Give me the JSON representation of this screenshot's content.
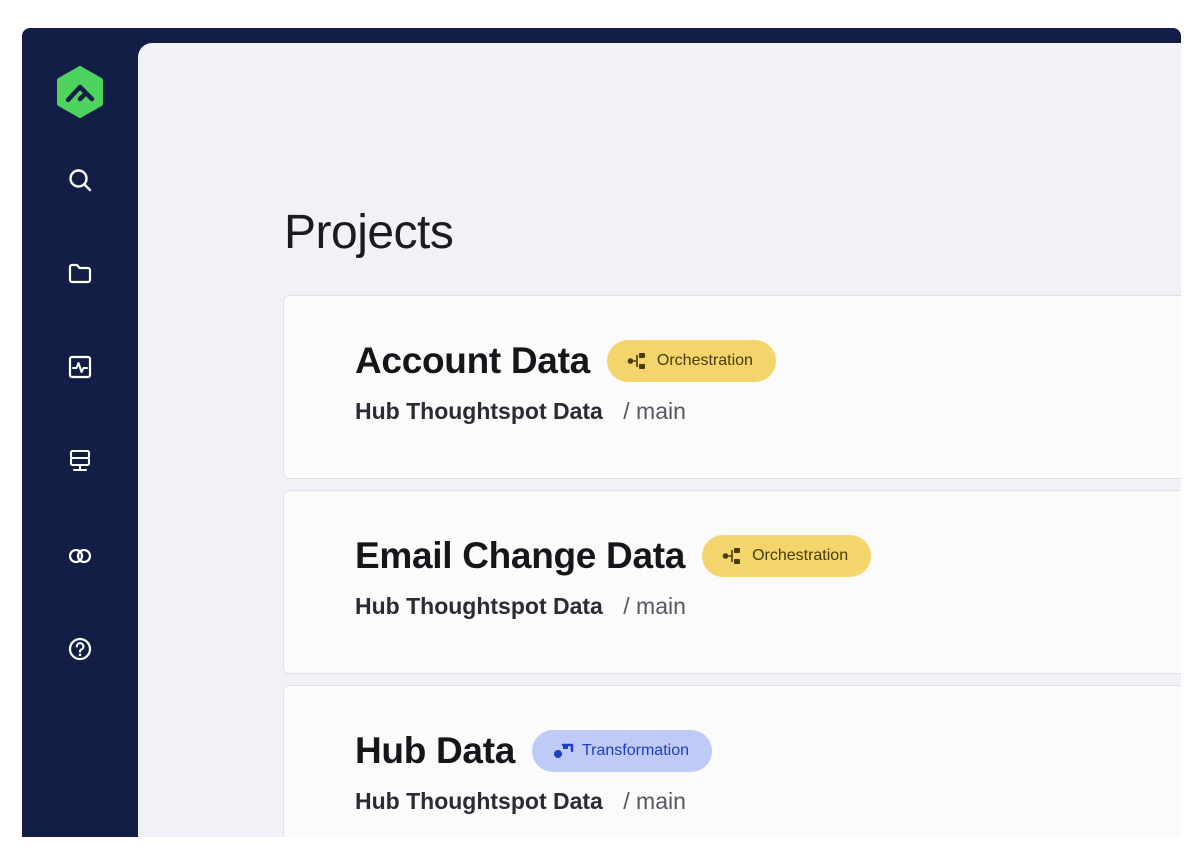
{
  "sidebar": {
    "items": [
      {
        "icon": "search-icon",
        "name": "sidebar-item-search"
      },
      {
        "icon": "folder-icon",
        "name": "sidebar-item-projects"
      },
      {
        "icon": "activity-monitor-icon",
        "name": "sidebar-item-activity"
      },
      {
        "icon": "server-icon",
        "name": "sidebar-item-environments"
      },
      {
        "icon": "integrations-icon",
        "name": "sidebar-item-integrations"
      },
      {
        "icon": "help-circle-icon",
        "name": "sidebar-item-help"
      }
    ],
    "logo_icon": "matillion-logo-icon"
  },
  "page": {
    "title": "Projects"
  },
  "projects": [
    {
      "title": "Account Data",
      "badge": "Orchestration",
      "badge_type": "orchestration",
      "project": "Hub Thoughtspot Data",
      "separator": "/",
      "branch": "main"
    },
    {
      "title": "Email Change Data",
      "badge": "Orchestration",
      "badge_type": "orchestration",
      "project": "Hub Thoughtspot Data",
      "separator": "/",
      "branch": "main"
    },
    {
      "title": "Hub Data",
      "badge": "Transformation",
      "badge_type": "transformation",
      "project": "Hub Thoughtspot Data",
      "separator": "/",
      "branch": "main"
    }
  ],
  "colors": {
    "sidebar_bg": "#121e46",
    "content_bg": "#f0f2f7",
    "logo_green": "#4fd35f",
    "orchestration_badge": "#f4d56b",
    "transformation_badge": "#bfcbf7",
    "transformation_text": "#1f3fc0"
  }
}
